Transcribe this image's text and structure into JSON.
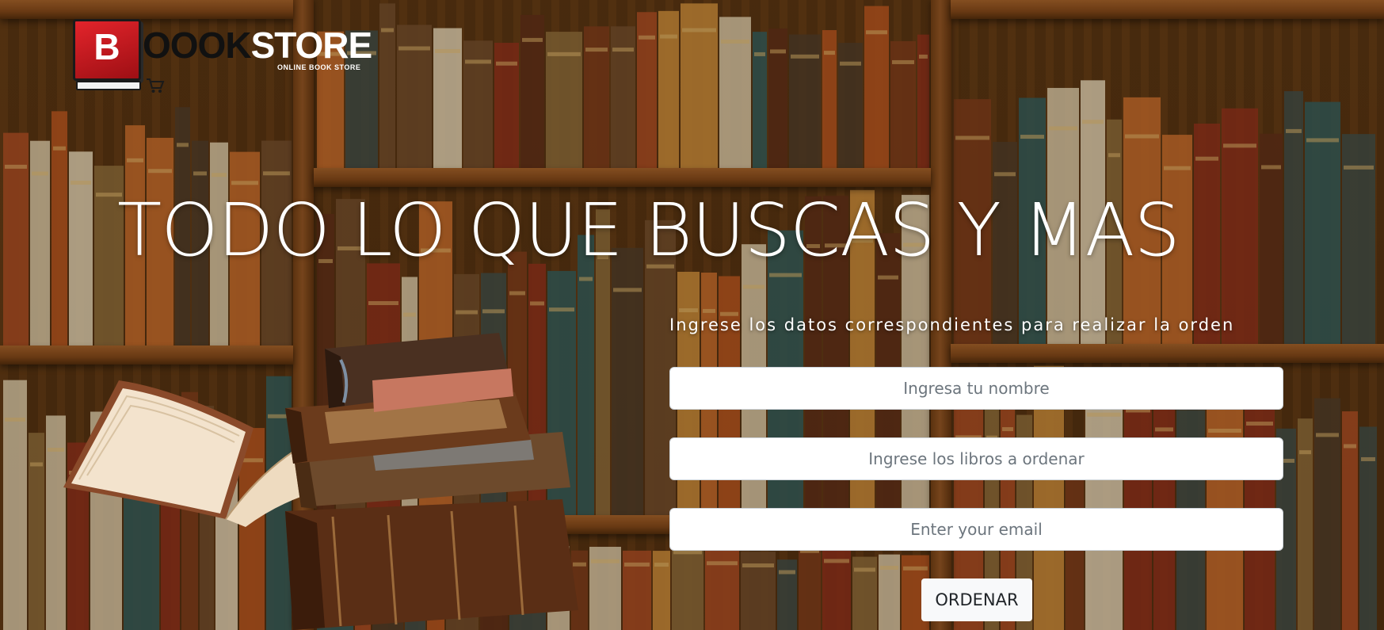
{
  "logo": {
    "badge_letter": "B",
    "word_dark": "OOOK",
    "word_light": "STORE",
    "tagline": "ONLINE BOOK STORE"
  },
  "hero": {
    "headline": "TODO LO QUE BUSCAS Y MAS"
  },
  "order_form": {
    "instructions": "Ingrese los datos correspondientes para realizar la orden",
    "name_placeholder": "Ingresa tu nombre",
    "books_placeholder": "Ingrese los libros a ordenar",
    "email_placeholder": "Enter your email",
    "submit_label": "ORDENAR"
  },
  "icons": {
    "cart": "shopping-cart-icon"
  },
  "colors": {
    "background": "#5a3613",
    "logo_red": "#e3242b",
    "text_light": "#ffffff",
    "button_bg": "#f8f9fa"
  }
}
